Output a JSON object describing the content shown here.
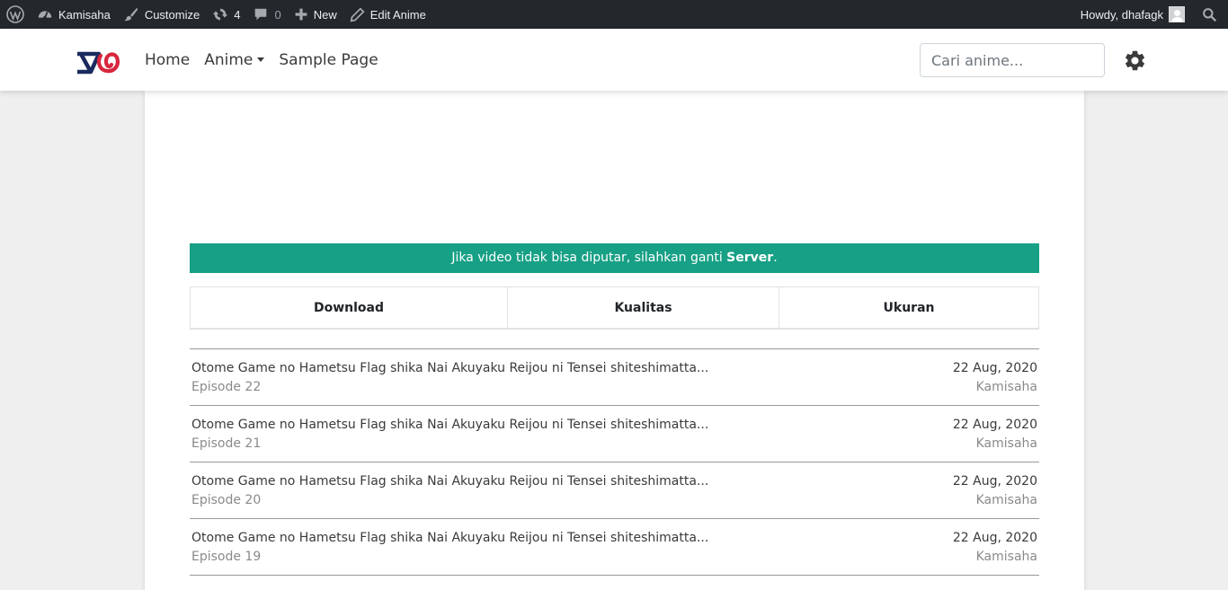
{
  "adminbar": {
    "items": [
      {
        "icon": "wordpress-icon",
        "label": ""
      },
      {
        "icon": "dashboard-icon",
        "label": "Kamisaha"
      },
      {
        "icon": "paintbrush-icon",
        "label": "Customize"
      },
      {
        "icon": "updates-icon",
        "label": "4"
      },
      {
        "icon": "comment-icon",
        "label": "0"
      },
      {
        "icon": "plus-icon",
        "label": "New"
      },
      {
        "icon": "pencil-icon",
        "label": "Edit Anime"
      }
    ],
    "greeting": "Howdy, dhafagk"
  },
  "header": {
    "nav": {
      "home": "Home",
      "anime": "Anime",
      "sample": "Sample Page"
    },
    "search_placeholder": "Cari anime...",
    "logo_color_dark": "#1b2a5e",
    "logo_color_red": "#d7263d"
  },
  "notice": {
    "text_before": "Jika video tidak bisa diputar, silahkan ganti ",
    "bold": "Server",
    "text_after": ".",
    "color": "#17a085"
  },
  "download_table": {
    "headers": [
      "Download",
      "Kualitas",
      "Ukuran"
    ]
  },
  "episodes": [
    {
      "title": "Otome Game no Hametsu Flag shika Nai Akuyaku Reijou ni Tensei shiteshimatta...",
      "episode": "Episode 22",
      "date": "22 Aug, 2020",
      "author": "Kamisaha"
    },
    {
      "title": "Otome Game no Hametsu Flag shika Nai Akuyaku Reijou ni Tensei shiteshimatta...",
      "episode": "Episode 21",
      "date": "22 Aug, 2020",
      "author": "Kamisaha"
    },
    {
      "title": "Otome Game no Hametsu Flag shika Nai Akuyaku Reijou ni Tensei shiteshimatta...",
      "episode": "Episode 20",
      "date": "22 Aug, 2020",
      "author": "Kamisaha"
    },
    {
      "title": "Otome Game no Hametsu Flag shika Nai Akuyaku Reijou ni Tensei shiteshimatta...",
      "episode": "Episode 19",
      "date": "22 Aug, 2020",
      "author": "Kamisaha"
    }
  ]
}
